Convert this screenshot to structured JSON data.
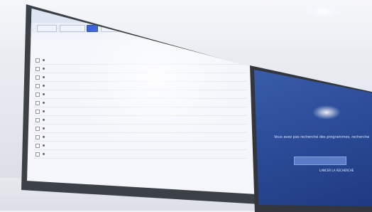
{
  "scene": {
    "wall_color": "#e6e8ee",
    "light_color": "#ffffff"
  },
  "left_screen": {
    "accent": "#3b62d6",
    "app_title": "",
    "toolbar_labels": [
      "",
      "",
      "",
      ""
    ],
    "footer_text": "",
    "rows": 13
  },
  "right_screen": {
    "background": "#2d4e9b",
    "message": "Vous avez pas recherché des programmes, recherche",
    "link_label": "LANCER LA RECHERCHE"
  }
}
